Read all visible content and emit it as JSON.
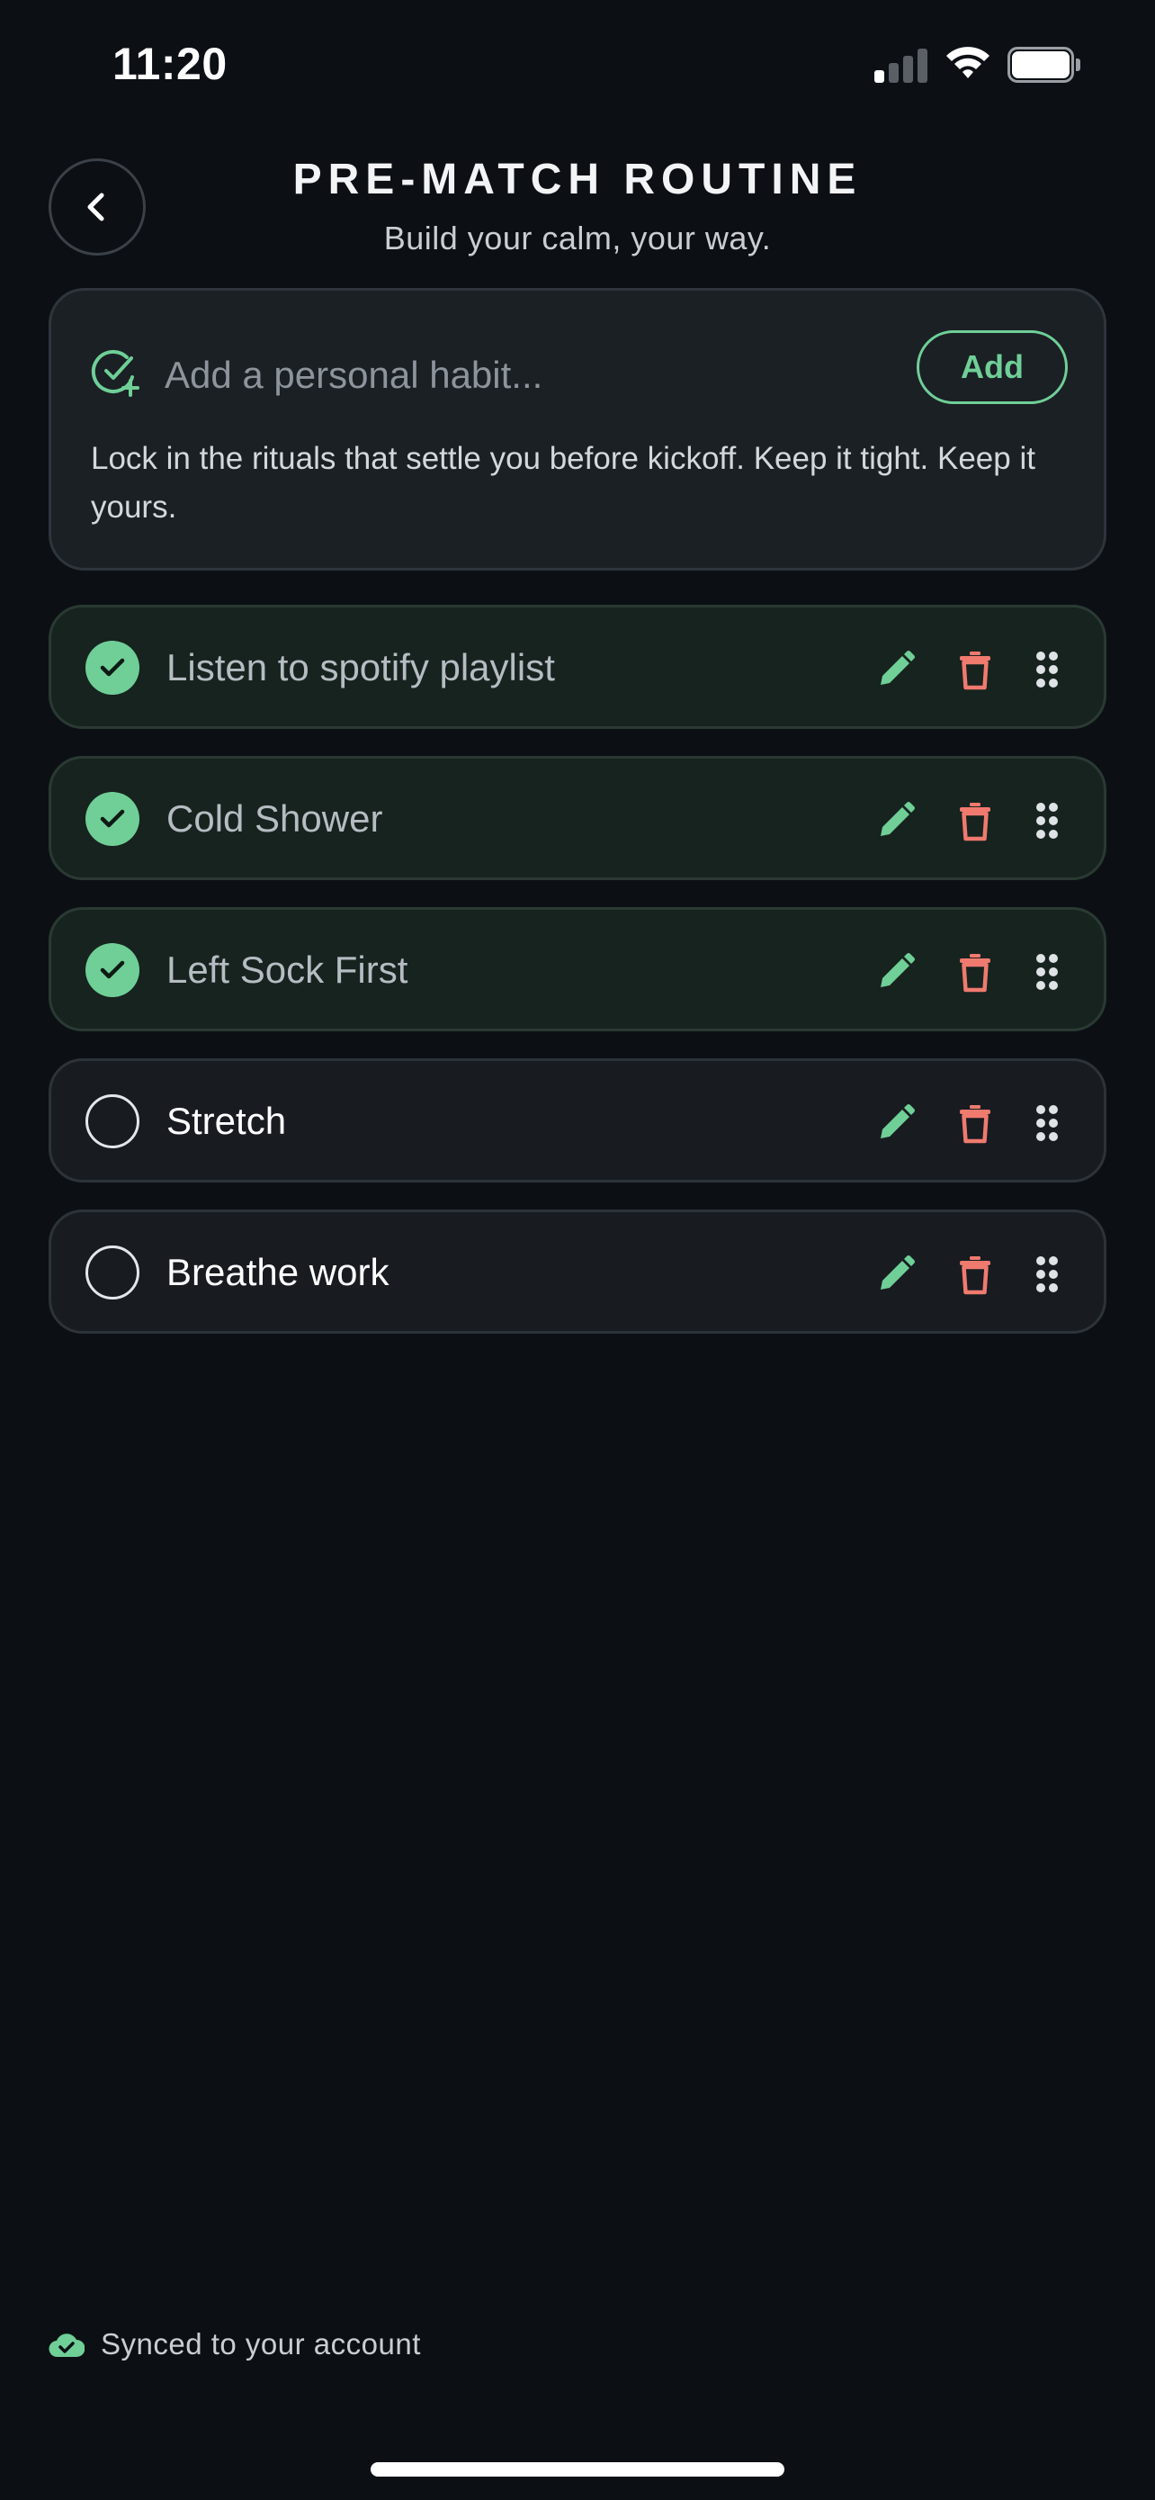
{
  "status_bar": {
    "time": "11:20",
    "signal_bars_active": 1,
    "signal_bars_total": 4,
    "battery_level": 1.0
  },
  "header": {
    "title": "PRE-MATCH ROUTINE",
    "subtitle": "Build your calm, your way.",
    "back_icon": "chevron-left-icon"
  },
  "add_habit": {
    "icon": "check-plus-icon",
    "placeholder": "Add a personal habit...",
    "value": "",
    "button_label": "Add",
    "description": "Lock in the rituals that settle you before kickoff. Keep it tight. Keep it yours."
  },
  "habits": [
    {
      "label": "Listen to spotify playlist",
      "done": true
    },
    {
      "label": "Cold Shower",
      "done": true
    },
    {
      "label": "Left Sock First",
      "done": true
    },
    {
      "label": "Stretch",
      "done": false
    },
    {
      "label": "Breathe work",
      "done": false
    }
  ],
  "habit_actions": {
    "edit_icon": "pencil-icon",
    "delete_icon": "trash-icon",
    "drag_icon": "drag-handle-icon"
  },
  "footer": {
    "sync_icon": "cloud-check-icon",
    "sync_text": "Synced to your account"
  },
  "colors": {
    "background": "#0c1015",
    "card": "#1b2025",
    "accent_green": "#6fcf97",
    "delete_red": "#f07a6e"
  }
}
